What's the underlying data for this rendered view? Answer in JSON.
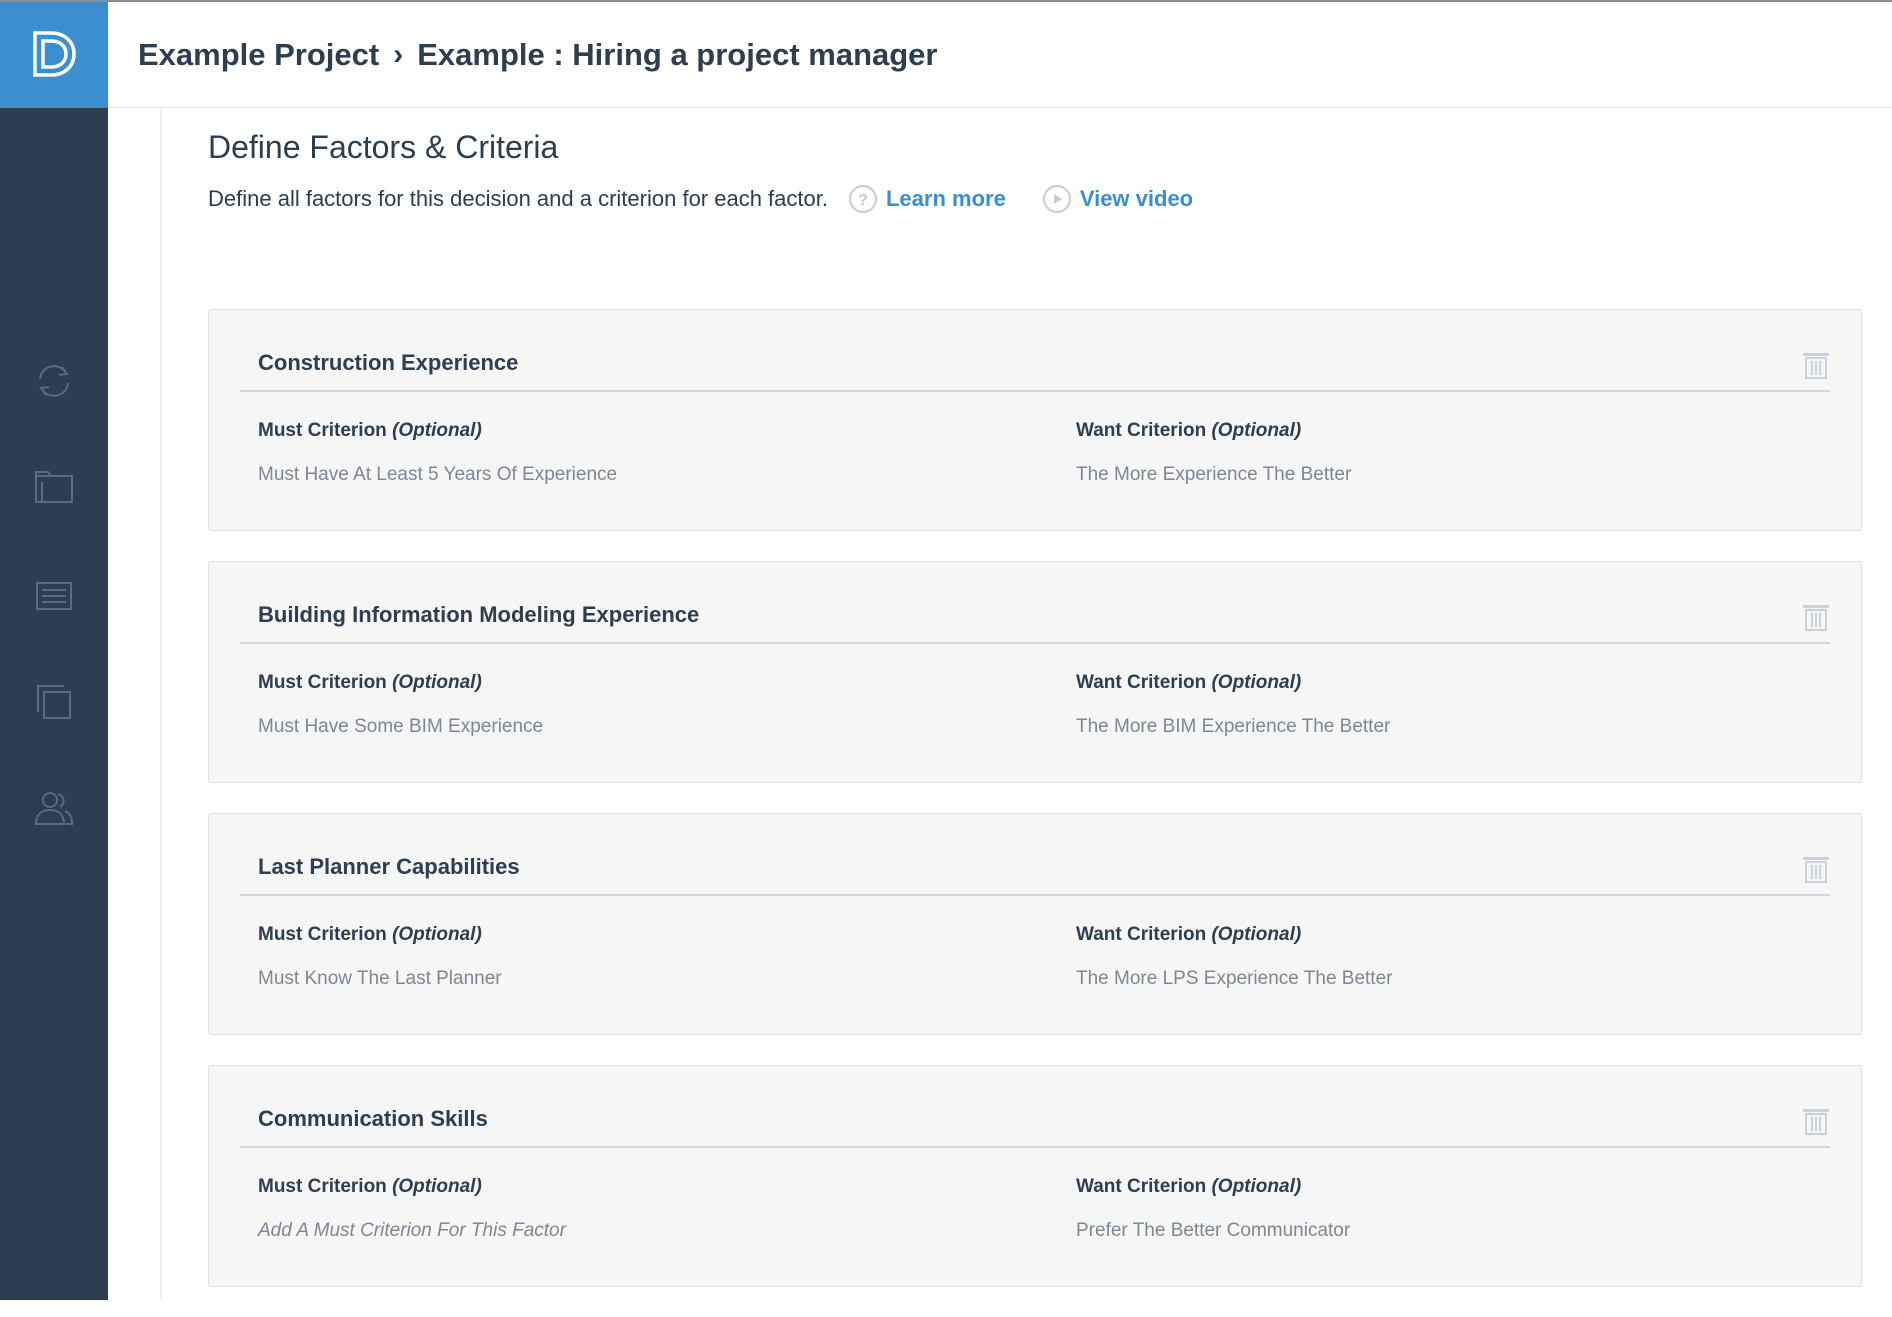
{
  "breadcrumb": {
    "project": "Example Project",
    "separator": "›",
    "decision": "Example : Hiring a project manager"
  },
  "page": {
    "title": "Define Factors & Criteria",
    "description": "Define all factors for this decision and a criterion for each factor.",
    "learn_more": "Learn more",
    "view_video": "View video"
  },
  "labels": {
    "must": "Must Criterion",
    "want": "Want Criterion",
    "optional": "(Optional)"
  },
  "factors": [
    {
      "title": "Construction Experience",
      "must": "Must Have At Least 5 Years Of Experience",
      "want": "The More Experience The Better"
    },
    {
      "title": "Building Information Modeling Experience",
      "must": "Must Have Some BIM Experience",
      "want": "The More BIM Experience The Better"
    },
    {
      "title": "Last Planner Capabilities",
      "must": "Must Know The Last Planner",
      "want": "The More LPS Experience The Better"
    },
    {
      "title": "Communication Skills",
      "must": "Add A Must Criterion For This Factor",
      "want": "Prefer The Better Communicator",
      "must_is_placeholder": true
    }
  ],
  "colors": {
    "sidebar": "#2d3e50",
    "logo_bg": "#3b8fd0",
    "link": "#3b8fd0",
    "text": "#2c3e50",
    "muted": "#7d8793",
    "card_bg": "#f6f6f6"
  },
  "icons": {
    "logo": "logo-icon",
    "nav": [
      "sync-icon",
      "folder-icon",
      "list-icon",
      "copy-icon",
      "users-icon"
    ],
    "help": "question-circle-icon",
    "video": "play-circle-icon",
    "delete": "trash-icon"
  }
}
